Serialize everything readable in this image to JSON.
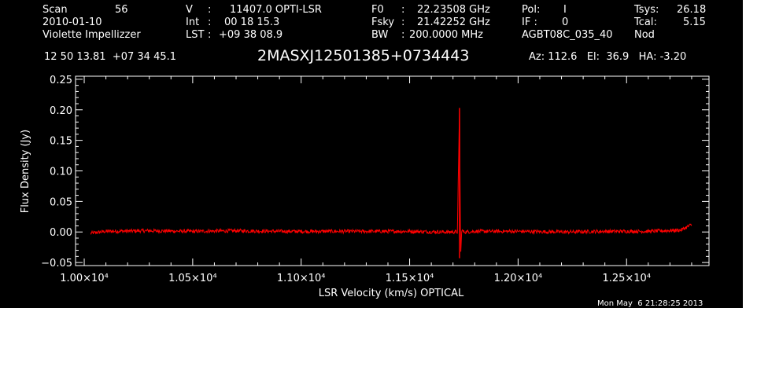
{
  "header": {
    "scan_label": "Scan",
    "scan_value": "56",
    "date": "2010-01-10",
    "observer": "Violette Impellizzer",
    "v_label": "V",
    "v_colon": ":",
    "v_value": "11407.0 OPTI-LSR",
    "int_label": "Int",
    "int_colon": ":",
    "int_value": "00 18 15.3",
    "lst_label": "LST",
    "lst_colon": ":",
    "lst_value": "+09 38 08.9",
    "f0_label": "F0",
    "f0_colon": ":",
    "f0_value": "22.23508 GHz",
    "fsky_label": "Fsky",
    "fsky_colon": ":",
    "fsky_value": "21.42252 GHz",
    "bw_label": "BW",
    "bw_colon": ":",
    "bw_value": "200.0000 MHz",
    "pol_label": "Pol:",
    "pol_value": "I",
    "if_label": "IF :",
    "if_value": "0",
    "project": "AGBT08C_035_40",
    "tsys_label": "Tsys:",
    "tsys_value": "26.18",
    "tcal_label": "Tcal:",
    "tcal_value": "5.15",
    "mode": "Nod",
    "ra_dec": "12 50 13.81  +07 34 45.1",
    "source": "2MASXJ12501385+0734443",
    "az_el_ha": "Az: 112.6   El:  36.9   HA: -3.20"
  },
  "footer": {
    "timestamp": "Mon May  6 21:28:25 2013"
  },
  "colors": {
    "background": "#000000",
    "axes": "#ffffff",
    "spectrum": "#ff0000"
  },
  "chart_data": {
    "type": "line",
    "title": "2MASXJ12501385+0734443",
    "xlabel": "LSR Velocity (km/s) OPTICAL",
    "ylabel": "Flux Density (Jy)",
    "xlim": [
      9960,
      12880
    ],
    "ylim": [
      -0.055,
      0.255
    ],
    "x_ticks": [
      {
        "value": 10000,
        "label": "1.00×10⁴"
      },
      {
        "value": 10500,
        "label": "1.05×10⁴"
      },
      {
        "value": 11000,
        "label": "1.10×10⁴"
      },
      {
        "value": 11500,
        "label": "1.15×10⁴"
      },
      {
        "value": 12000,
        "label": "1.20×10⁴"
      },
      {
        "value": 12500,
        "label": "1.25×10⁴"
      }
    ],
    "y_ticks": [
      {
        "value": -0.05,
        "label": "−0.05"
      },
      {
        "value": 0.0,
        "label": "0.00"
      },
      {
        "value": 0.05,
        "label": "0.05"
      },
      {
        "value": 0.1,
        "label": "0.10"
      },
      {
        "value": 0.15,
        "label": "0.15"
      },
      {
        "value": 0.2,
        "label": "0.20"
      },
      {
        "value": 0.25,
        "label": "0.25"
      }
    ],
    "grid": false,
    "series": [
      {
        "color": "#ff0000",
        "noise_rms": 0.003,
        "x": [
          10030,
          10100,
          10300,
          10500,
          10700,
          10900,
          11100,
          11300,
          11500,
          11650,
          11720,
          11730,
          11735,
          11740,
          11750,
          11800,
          12000,
          12200,
          12400,
          12600,
          12750,
          12800
        ],
        "y": [
          -0.002,
          0.001,
          0.002,
          0.001,
          0.002,
          0.001,
          0.001,
          0.001,
          0.001,
          0.0,
          0.0,
          0.203,
          -0.043,
          0.003,
          0.0,
          0.001,
          0.001,
          0.0,
          0.001,
          0.001,
          0.003,
          0.012
        ]
      }
    ]
  }
}
